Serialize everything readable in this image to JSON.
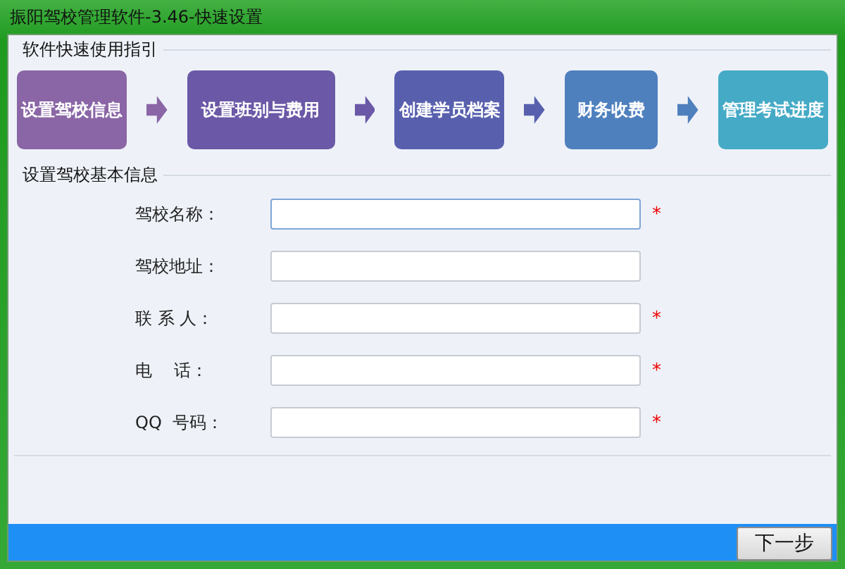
{
  "window": {
    "title": "振阳驾校管理软件-3.46-快速设置"
  },
  "guide": {
    "title": "软件快速使用指引",
    "steps": [
      {
        "label": "设置驾校信息",
        "color": "#8a66a6"
      },
      {
        "label": "设置班别与费用",
        "color": "#6b58a6"
      },
      {
        "label": "创建学员档案",
        "color": "#5860ae"
      },
      {
        "label": "财务收费",
        "color": "#4f80be"
      },
      {
        "label": "管理考试进度",
        "color": "#45aac6"
      }
    ]
  },
  "form": {
    "title": "设置驾校基本信息",
    "fields": [
      {
        "label": "驾校名称：",
        "required_mark": "*",
        "focused": true
      },
      {
        "label": "驾校地址：",
        "focused": false
      },
      {
        "label": "联 系 人：",
        "required_mark": "*",
        "focused": false
      },
      {
        "label": "电    话：",
        "required_mark": "*",
        "focused": false
      },
      {
        "label": "QQ  号码：",
        "required_mark": "*",
        "focused": false
      }
    ]
  },
  "buttons": [
    {
      "label": "下一步"
    }
  ]
}
